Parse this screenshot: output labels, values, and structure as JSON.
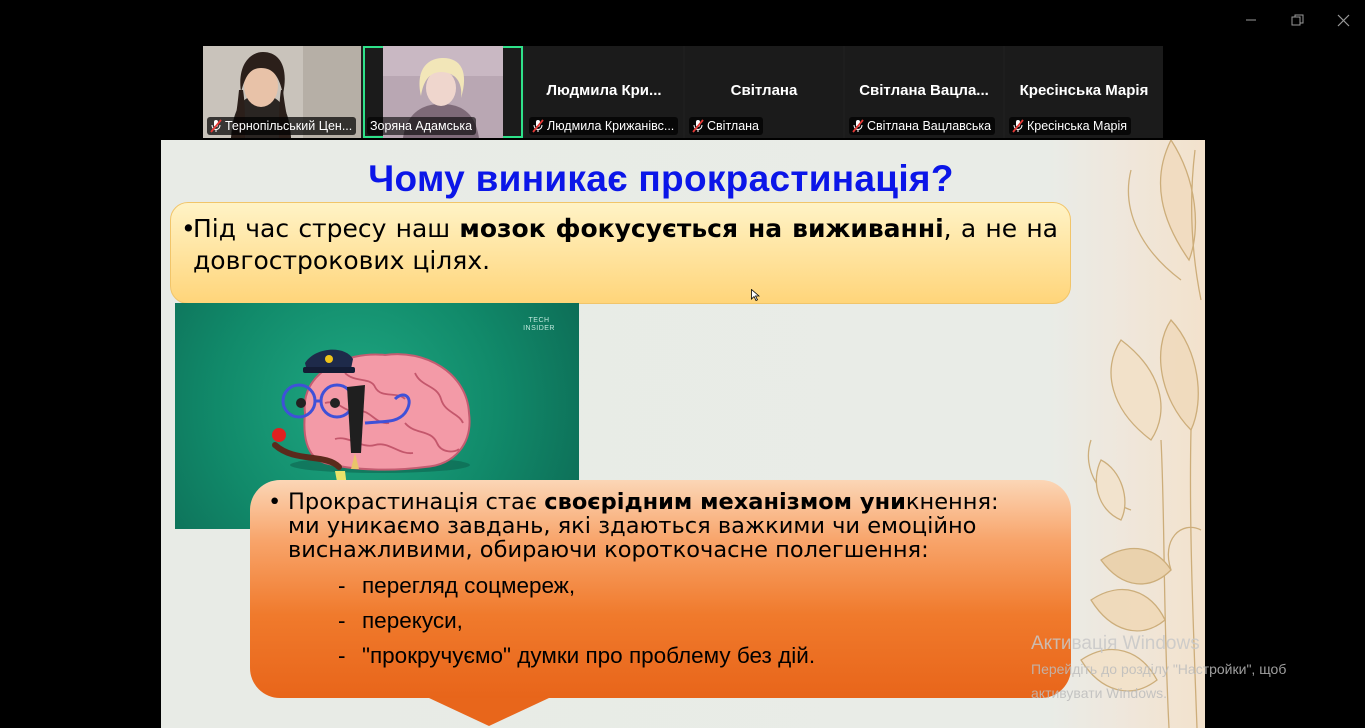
{
  "window": {
    "minimize_icon": "minimize-icon",
    "restore_icon": "restore-icon",
    "close_icon": "close-icon"
  },
  "participants": [
    {
      "name": "Тернопільський Цен...",
      "has_video": true,
      "muted": true
    },
    {
      "name": "Зоряна Адамська",
      "has_video": true,
      "muted": false,
      "active_speaker": true
    },
    {
      "display_name": "Людмила  Кри...",
      "name": "Людмила Крижанівс...",
      "has_video": false,
      "muted": true
    },
    {
      "display_name": "Світлана",
      "name": "Світлана",
      "has_video": false,
      "muted": true
    },
    {
      "display_name": "Світлана  Вацла...",
      "name": "Світлана Вацлавська",
      "has_video": false,
      "muted": true
    },
    {
      "display_name": "Кресінська Марія",
      "name": "Кресінська Марія",
      "has_video": false,
      "muted": true
    }
  ],
  "slide": {
    "title": "Чому виникає прокрастинація?",
    "point1": {
      "before": "Під час стресу наш ",
      "bold": "мозок фокусується на виживанні",
      "after": ", а не на довгострокових цілях."
    },
    "image_watermark": [
      "TECH",
      "INSIDER"
    ],
    "point2": {
      "before": "Прокрастинація стає ",
      "bold": "своєрідним механізмом уни",
      "after": "кнення: ми уникаємо завдань, які здаються важкими чи емоційно виснажливими, обираючи короткочасне полегшення:"
    },
    "sub_items": [
      "перегляд соцмереж,",
      "перекуси,",
      "\"прокручуємо\" думки про проблему без дій."
    ]
  },
  "activation": {
    "title": "Активація Windows",
    "line1": "Перейдіть до розділу \"Настройки\", щоб",
    "line2": "активувати Windows."
  },
  "colors": {
    "title": "#0b16e8",
    "box1": "#ffd57a",
    "box2": "#f07a2c",
    "active_outline": "#2fe28a",
    "mute_red": "#e53935"
  }
}
